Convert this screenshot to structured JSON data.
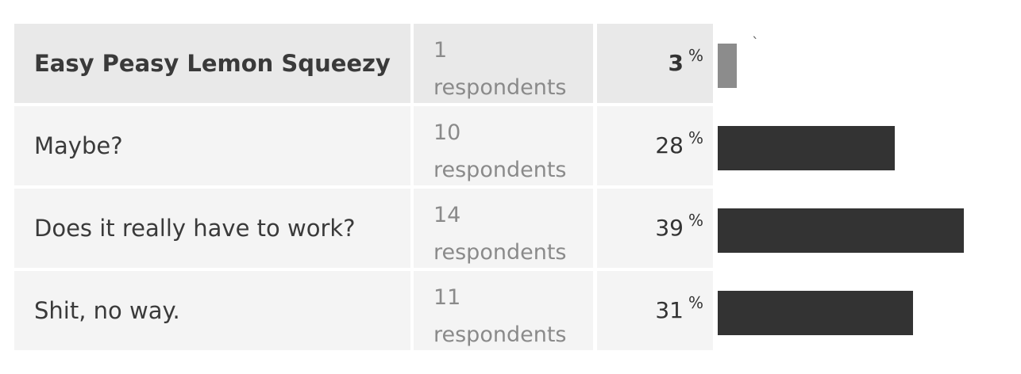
{
  "poll": {
    "bar_color": "#333333",
    "winner_bar_color": "#8c8c8c",
    "rows": [
      {
        "answer": "Easy Peasy Lemon Squeezy",
        "count": "1",
        "unit": "respondents",
        "percent": "3",
        "percent_sign": "%",
        "share": 0.03,
        "highlighted": true,
        "mark": "`"
      },
      {
        "answer": "Maybe?",
        "count": "10",
        "unit": "respondents",
        "percent": "28",
        "percent_sign": "%",
        "share": 0.28,
        "highlighted": false
      },
      {
        "answer": "Does it really have to work?",
        "count": "14",
        "unit": "respondents",
        "percent": "39",
        "percent_sign": "%",
        "share": 0.39,
        "highlighted": false
      },
      {
        "answer": "Shit, no way.",
        "count": "11",
        "unit": "respondents",
        "percent": "31",
        "percent_sign": "%",
        "share": 0.31,
        "highlighted": false
      }
    ]
  }
}
